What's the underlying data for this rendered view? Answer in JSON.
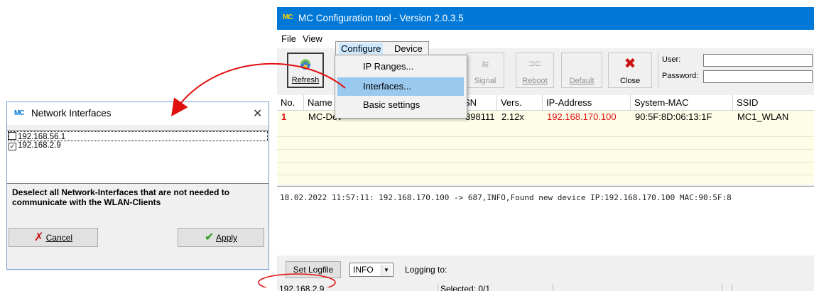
{
  "app": {
    "icon_text": "MC",
    "title": "MC Configuration tool - Version 2.0.3.5"
  },
  "menubar": {
    "file": "File",
    "view": "View",
    "configure_hidden": "Configure",
    "device_hidden": "Device"
  },
  "open_menu": {
    "configure": "Configure",
    "device": "Device",
    "items": [
      "IP Ranges...",
      "Interfaces...",
      "Basic settings"
    ]
  },
  "toolbar": {
    "refresh": "Refresh",
    "signal": "Signal",
    "reboot": "Reboot",
    "default": "Default",
    "close": "Close",
    "user_label": "User:",
    "password_label": "Password:",
    "user_value": "",
    "password_value": ""
  },
  "table": {
    "columns": [
      "No.",
      "Name",
      "SN",
      "Vers.",
      "IP-Address",
      "System-MAC",
      "SSID"
    ],
    "rows": [
      {
        "no": "1",
        "name": "MC-Dev",
        "sn": "398111",
        "vers": "2.12x",
        "ip": "192.168.170.100",
        "mac": "90:5F:8D:06:13:1F",
        "ssid": "MC1_WLAN"
      }
    ]
  },
  "log": {
    "line": "18.02.2022 11:57:11: 192.168.170.100 -> 687,INFO,Found new device IP:192.168.170.100 MAC:90:5F:8"
  },
  "controls": {
    "set_logfile": "Set Logfile",
    "log_level": "INFO",
    "logging_to": "Logging to:"
  },
  "status": {
    "ip": "192.168.2.9",
    "selected": "Selected: 0/1"
  },
  "dialog": {
    "title": "Network Interfaces",
    "interfaces": [
      {
        "label": "192.168.56.1",
        "checked": false
      },
      {
        "label": "192.168.2.9",
        "checked": true
      }
    ],
    "message": "Deselect all Network-Interfaces that are not needed to communicate with the WLAN-Clients",
    "cancel": "Cancel",
    "apply": "Apply"
  },
  "colors": {
    "titlebar": "#0078d7",
    "highlight_row": "#fdfde8",
    "accent_red": "#e01010",
    "menu_highlight": "#99c9ef"
  }
}
